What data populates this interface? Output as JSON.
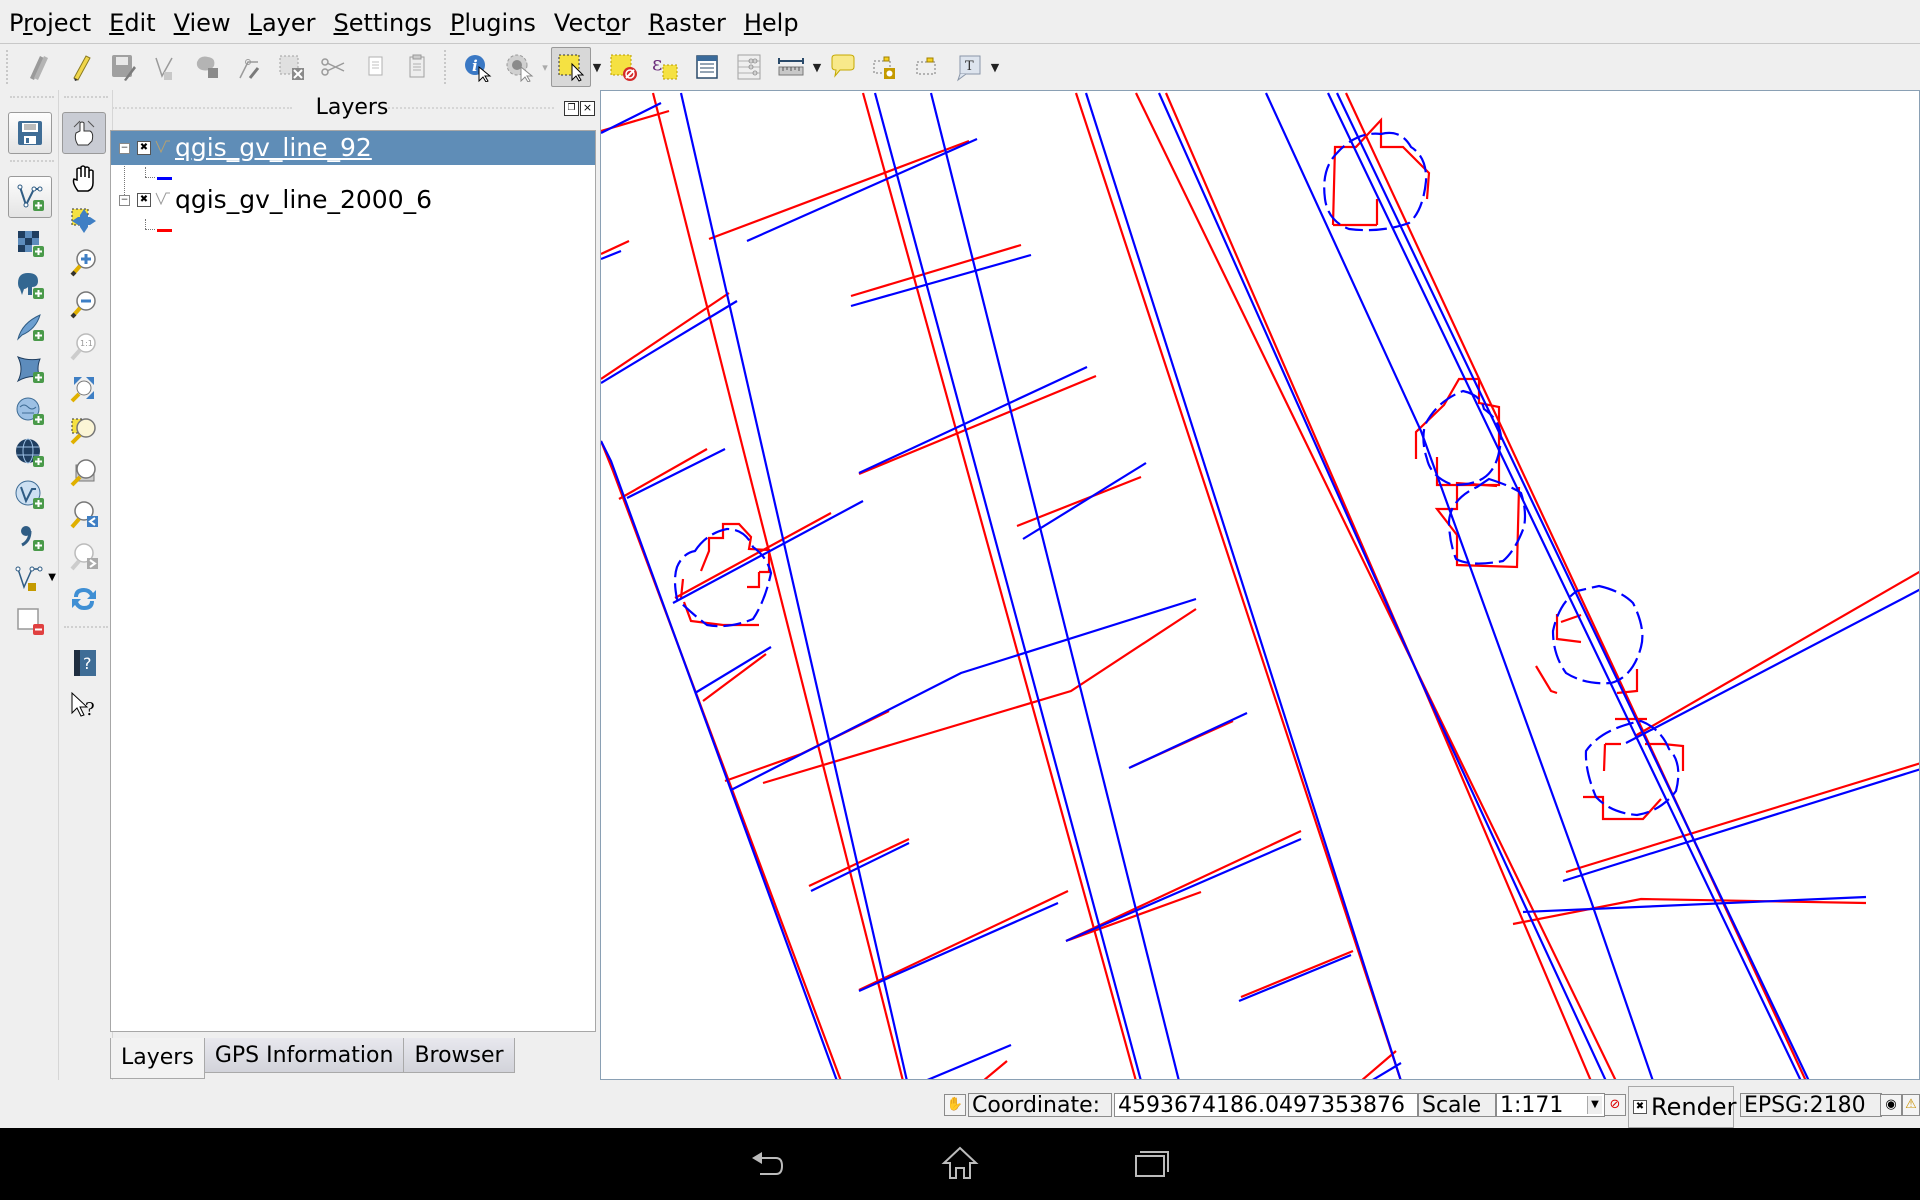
{
  "menubar": {
    "items": [
      {
        "label": "Project",
        "mnemonic_index": 1
      },
      {
        "label": "Edit",
        "mnemonic_index": 0
      },
      {
        "label": "View",
        "mnemonic_index": 0
      },
      {
        "label": "Layer",
        "mnemonic_index": 0
      },
      {
        "label": "Settings",
        "mnemonic_index": 0
      },
      {
        "label": "Plugins",
        "mnemonic_index": 0
      },
      {
        "label": "Vector",
        "mnemonic_index": 4
      },
      {
        "label": "Raster",
        "mnemonic_index": 0
      },
      {
        "label": "Help",
        "mnemonic_index": 0
      }
    ]
  },
  "toolbar": {
    "icons": [
      "current-edits-icon",
      "toggle-editing-icon",
      "save-layer-edits-icon",
      "add-feature-icon",
      "move-feature-icon",
      "node-tool-icon",
      "delete-selected-icon",
      "cut-features-icon",
      "copy-features-icon",
      "paste-features-icon",
      "identify-features-icon",
      "run-feature-action-icon",
      "select-features-icon",
      "deselect-all-icon",
      "select-by-expression-icon",
      "open-attribute-table-icon",
      "field-calculator-icon",
      "measure-line-icon",
      "map-tips-icon",
      "new-bookmark-icon",
      "show-bookmarks-icon",
      "text-annotation-icon"
    ]
  },
  "left_toolbar_1": {
    "icons": [
      "save-project-icon",
      "add-vector-layer-icon",
      "add-raster-layer-icon",
      "add-postgis-layer-icon",
      "add-spatialite-layer-icon",
      "add-mssql-layer-icon",
      "add-wms-layer-icon",
      "add-wcs-layer-icon",
      "add-wfs-layer-icon",
      "add-delimited-text-layer-icon",
      "new-vector-layer-icon",
      "remove-layer-icon"
    ]
  },
  "left_toolbar_2": {
    "icons": [
      "touch-zoom-pan-icon",
      "pan-map-icon",
      "pan-to-selection-icon",
      "zoom-in-icon",
      "zoom-out-icon",
      "zoom-actual-size-icon",
      "zoom-full-icon",
      "zoom-to-selection-icon",
      "zoom-to-layer-icon",
      "zoom-last-icon",
      "zoom-next-icon",
      "refresh-icon",
      "help-contents-icon",
      "whats-this-icon"
    ]
  },
  "layers_panel": {
    "title": "Layers",
    "layers": [
      {
        "name": "qgis_gv_line_92",
        "visible": true,
        "selected": true,
        "symbol_color": "#0000ff"
      },
      {
        "name": "qgis_gv_line_2000_6",
        "visible": true,
        "selected": false,
        "symbol_color": "#ff0000"
      }
    ],
    "tabs": [
      {
        "label": "Layers",
        "active": true
      },
      {
        "label": "GPS Information",
        "active": false
      },
      {
        "label": "Browser",
        "active": false
      }
    ]
  },
  "map": {
    "series_colors": {
      "qgis_gv_line_92": "#0000ff",
      "qgis_gv_line_2000_6": "#ff0000"
    }
  },
  "statusbar": {
    "coordinate_label": "Coordinate:",
    "coordinate_value": "4593674186.0497353876",
    "scale_label": "Scale",
    "scale_value": "1:171",
    "render_label": "Render",
    "render_checked": true,
    "crs": "EPSG:2180"
  },
  "android_nav": {
    "buttons": [
      "back",
      "home",
      "recent-apps"
    ]
  }
}
